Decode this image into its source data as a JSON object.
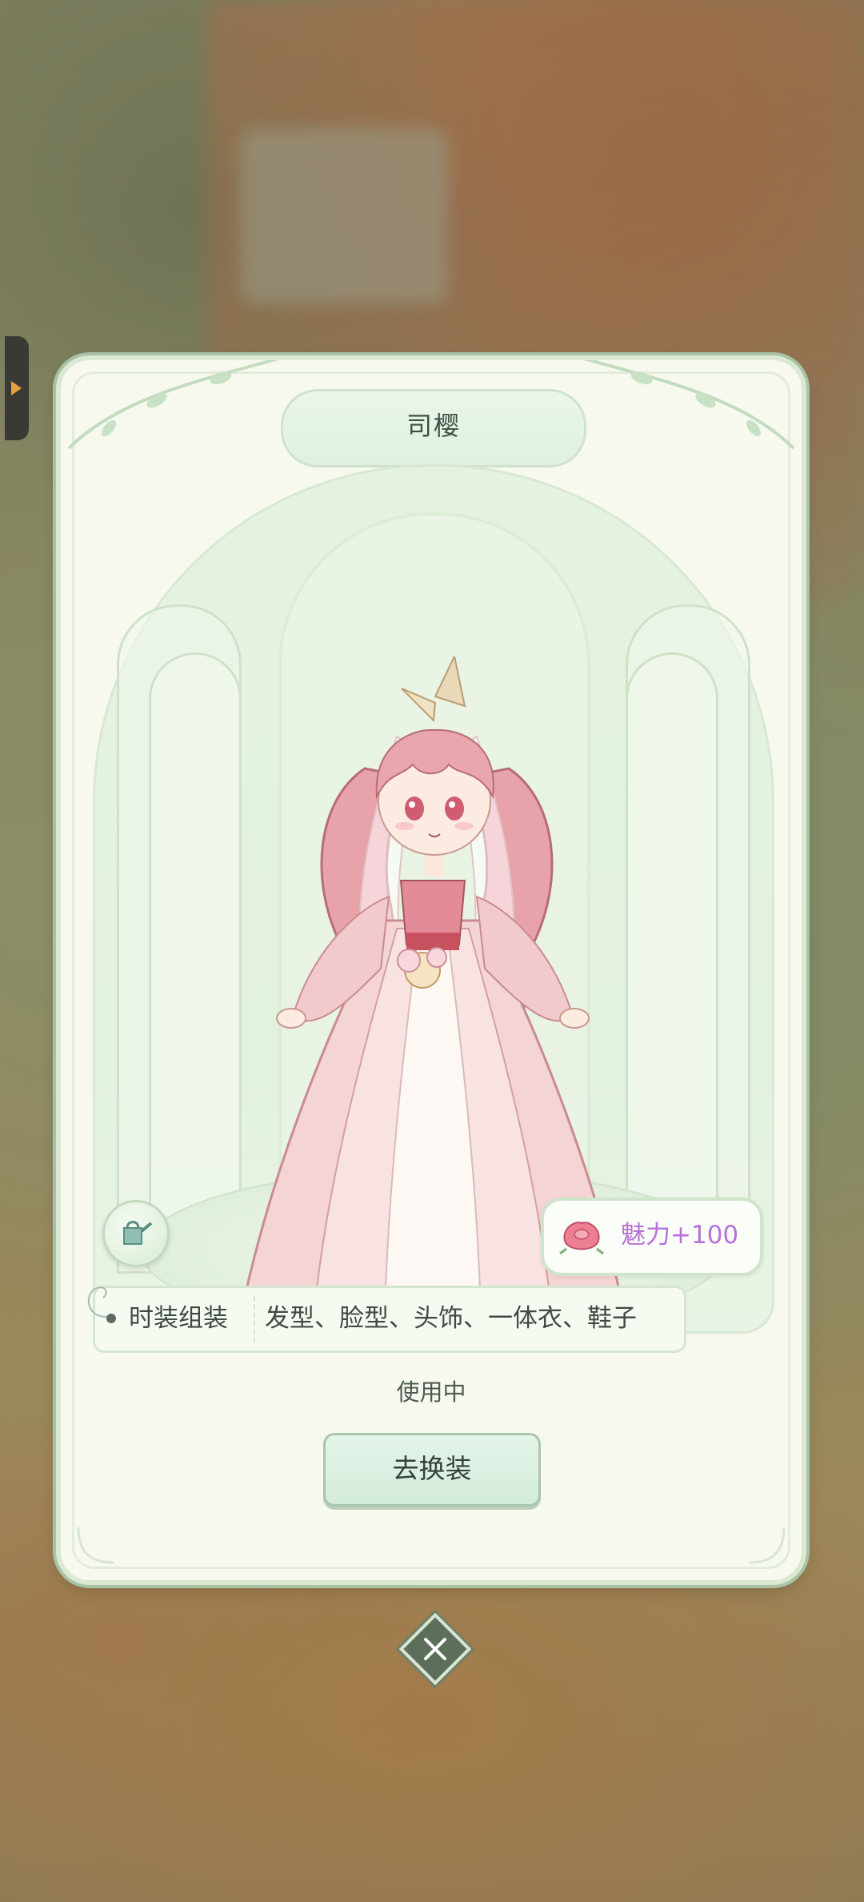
{
  "card": {
    "title": "司樱",
    "charm": {
      "label": "魅力+100",
      "icon": "rose-icon",
      "color": "#b672d8"
    },
    "outfit": {
      "category": "时装组装",
      "parts": "发型、脸型、头饰、一体衣、鞋子"
    },
    "status": "使用中",
    "action_label": "去换装"
  },
  "icons": {
    "side_tab": "chevron-right-icon",
    "tool": "watering-can-icon",
    "close": "close-icon"
  },
  "colors": {
    "accent": "#a9c2a6",
    "card_bg": "#f7f9ef",
    "charm_text": "#b672d8"
  }
}
